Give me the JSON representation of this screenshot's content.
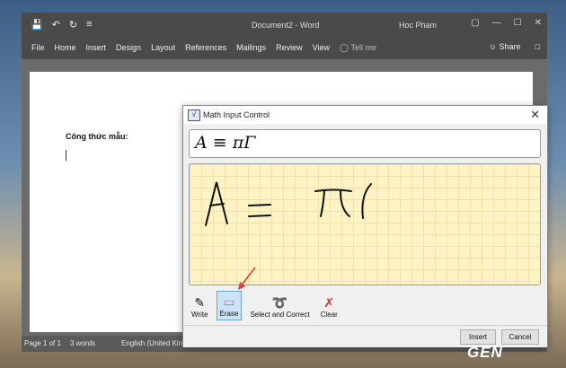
{
  "titlebar": {
    "document": "Document2 - Word",
    "user": "Hoc Pham"
  },
  "ribbon": {
    "tabs": [
      "File",
      "Home",
      "Insert",
      "Design",
      "Layout",
      "References",
      "Mailings",
      "Review",
      "View"
    ],
    "tell_me": "Tell me",
    "share": "Share"
  },
  "doc": {
    "heading": "Công thức mẫu:"
  },
  "status": {
    "page": "Page 1 of 1",
    "words": "3 words",
    "language": "English (United Kin"
  },
  "dialog": {
    "title": "Math Input Control",
    "equation": "A ≡ πΓ",
    "tools": [
      {
        "label": "Write",
        "icon": "pen-icon"
      },
      {
        "label": "Erase",
        "icon": "eraser-icon",
        "selected": true
      },
      {
        "label": "Select and Correct",
        "icon": "lasso-icon"
      },
      {
        "label": "Clear",
        "icon": "clear-icon"
      }
    ],
    "insert": "Insert",
    "cancel": "Cancel"
  },
  "watermark": "GEN"
}
